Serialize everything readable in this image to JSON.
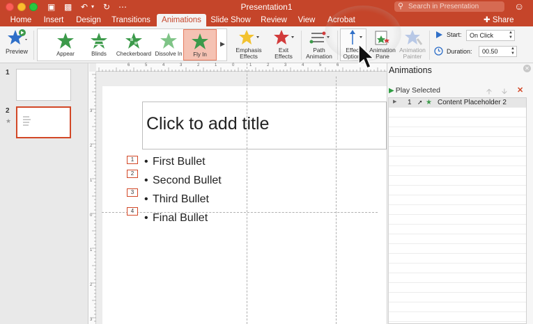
{
  "window": {
    "title": "Presentation1",
    "search_placeholder": "Search in Presentation"
  },
  "tabs": [
    {
      "label": "Home"
    },
    {
      "label": "Insert"
    },
    {
      "label": "Design"
    },
    {
      "label": "Transitions"
    },
    {
      "label": "Animations"
    },
    {
      "label": "Slide Show"
    },
    {
      "label": "Review"
    },
    {
      "label": "View"
    },
    {
      "label": "Acrobat"
    }
  ],
  "active_tab": "Animations",
  "share_label": "Share",
  "ribbon": {
    "preview": "Preview",
    "gallery": [
      {
        "label": "Appear",
        "color": "#3c9a4a"
      },
      {
        "label": "Blinds",
        "color": "#3c9a4a"
      },
      {
        "label": "Checkerboard",
        "color": "#3c9a4a"
      },
      {
        "label": "Dissolve In",
        "color": "#3c9a4a"
      },
      {
        "label": "Fly In",
        "color": "#3c9a4a"
      }
    ],
    "selected_effect": "Fly In",
    "emphasis": "Emphasis Effects",
    "exit": "Exit Effects",
    "path": "Path Animation",
    "effect_options": "Effect Options",
    "animation_pane": "Animation Pane",
    "animation_painter": "Animation Painter",
    "start_label": "Start:",
    "start_value": "On Click",
    "duration_label": "Duration:",
    "duration_value": "00.50"
  },
  "slides": [
    {
      "number": "1"
    },
    {
      "number": "2"
    }
  ],
  "slide": {
    "title_placeholder": "Click to add title",
    "bullets": [
      "First Bullet",
      "Second Bullet",
      "Third Bullet",
      "Final Bullet"
    ],
    "anim_tags": [
      "1",
      "2",
      "3",
      "4"
    ]
  },
  "ruler": {
    "horizontal": [
      "6",
      "5",
      "4",
      "3",
      "2",
      "1",
      "0",
      "1",
      "2",
      "3",
      "4",
      "5",
      "6"
    ],
    "vertical": [
      "3",
      "2",
      "1",
      "0",
      "1",
      "2",
      "3"
    ]
  },
  "pane": {
    "title": "Animations",
    "play_selected": "Play Selected",
    "items": [
      {
        "order": "1",
        "name": "Content Placeholder 2"
      }
    ]
  },
  "colors": {
    "brand": "#c5452a",
    "accent": "#d24726",
    "effect_green": "#3c9a4a",
    "emphasis_yellow": "#f2c230",
    "exit_red": "#d23b3b"
  }
}
